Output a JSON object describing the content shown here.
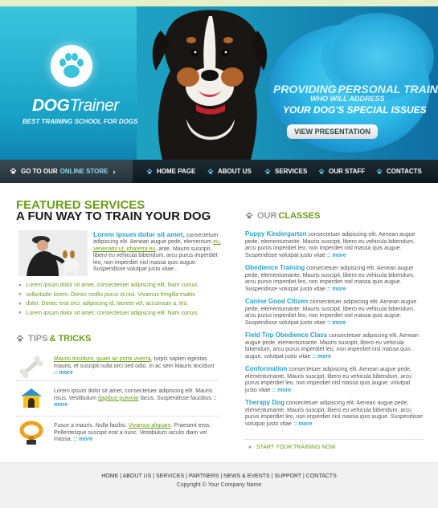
{
  "brand": {
    "logo_bold": "DOG",
    "logo_light": "Trainer",
    "tagline": "BEST TRAINING SCHOOL FOR DOGS"
  },
  "promo": {
    "line1_prefix": "PROVIDING",
    "line1_highlight": "PERSONAL TRAINERS",
    "line2": "WHO WILL ADDRESS",
    "line3": "YOUR DOG'S SPECIAL ISSUES",
    "button": "VIEW PRESENTATION"
  },
  "nav": {
    "store_prefix": "GO TO OUR",
    "store_highlight": "ONLINE STORE",
    "store_arrow": "›",
    "items": [
      "HOME PAGE",
      "ABOUT US",
      "SERVICES",
      "OUR STAFF",
      "CONTACTS"
    ]
  },
  "featured": {
    "heading1": "FEATURED SERVICES",
    "heading2": "A FUN WAY TO TRAIN YOUR DOG",
    "lead": "Lorem ipsum dolor sit amet,",
    "text1": " consectetuer adipiscing elit. Aenean augue pede, elementum",
    "link": "eu, venenatis ut, pharetra eu",
    "text2": ", ante. Mauris suscipit, libero eu vehicula bibendum, arcu purus imperdiet leo, non imperdiet nisl massa quis augue. Suspendisse volutpat justo vitae...",
    "bullets": [
      "Lorem ipsum dolor sit amet, consectetuer adipiscing elit. Nam cursus",
      "sollicitudin lorem. Donec mollis purus id nisl. Vivamus fringilla mattis",
      "dolor. Donec erat orci, adipiscing id, laoreet vel, accumsan a, leo.",
      "Lorem ipsum dolor sit amet, consectetuer adipiscing elit. Nam cursus"
    ]
  },
  "tips": {
    "heading_a": "TIPS",
    "heading_b": "& TRICKS",
    "more": ":: more",
    "items": [
      {
        "link": "Mauris tincidunt, quam ac porta viverra",
        "before": "",
        "after": ", turpis sapien egestas mauris, et suscipit nulla orci sed odio. In ac sem Mauris tincidunt "
      },
      {
        "link": "dapibus pulvinar",
        "before": "Lorem ipsum dolor sit amet, consectetuer adipiscing elit. Mauris risus. Vestibulum ",
        "after": " lacus. Suspendisse faucibus "
      },
      {
        "link": "Vivamus aliquam",
        "before": "Fusce a mauris. Nulla facilisi. ",
        "after": ". Praesent eros. Pellentesque suscipit erat a nunc. Vestibulum iaculis diam vel massa. "
      }
    ]
  },
  "classes": {
    "heading_a": "OUR",
    "heading_b": "CLASSES",
    "more": ":: more",
    "items": [
      {
        "title": "Puppy Kindergarten",
        "text": " consectetuer adipiscing elit. Aenean augue pede, elementumante. Mauris suscipit, libero eu vehicula bibendum, arcu purus imperdiet leo, non imperdiet nisl massa quis augue. Suspendisse volutpat justo vitae "
      },
      {
        "title": "Obedience Training",
        "text": " consectetuer adipiscing elit. Aenean augue pede, elementumante. Mauris suscipit, libero eu vehicula bibendum, arcu purus imperdiet leo, non imperdiet nisl massa quis augue. Suspendisse volutpat justo vitae "
      },
      {
        "title": "Canine Good Citizen",
        "text": " consectetuer adipiscing elit. Aenean augue pede, elementumante. Mauris suscipit, libero eu vehicula bibendum, arcu purus imperdiet leo, non imperdiet nisl massa quis augue. Suspendisse volutpat justo vitae "
      },
      {
        "title": "Field Trip Obedience Class",
        "text": " consectetuer adipiscing elit. Aenean augue pede, elementumante. Mauris suscipit, libero eu vehicula bibendum, arcu purus imperdiet leo, non imperdiet nisl massa quis augue. volutpat justo vitae "
      },
      {
        "title": "Conformation",
        "text": " consectetuer adipiscing elit. Aenean augue pede, elementumante. Mauris suscipit, libero eu vehicula bibendum, arcu purus imperdiet leo, non imperdiet nisl massa quis augue. volutpat justo vitae "
      },
      {
        "title": "Therapy Dog",
        "text": " consectetuer adipiscing elit. Aenean augue pede, elementumante. Mauris suscipit, libero eu vehicula bibendum, arcu purus imperdiet leo, non imperdiet nisl massa quis augue. Suspendisse volutpat justo vitae "
      }
    ],
    "start": "START YOUR TRAINING NOW"
  },
  "footer": {
    "links": [
      "HOME",
      "ABOUT US",
      "SERVICES",
      "PARTNERS",
      "NEWS & EVENTS",
      "SUPPORT",
      "CONTACTS"
    ],
    "separator": " | ",
    "copyright": "Copyright © Your Company Name"
  },
  "colors": {
    "accent_green": "#6a9c1a",
    "accent_blue": "#2aa0c9",
    "hero_blue": "#1c9dbf",
    "nav_dark": "#0e181d"
  },
  "icons": [
    "paw-icon",
    "bone-icon",
    "dog-house-icon",
    "dog-collar-icon",
    "arrow-right-icon"
  ]
}
